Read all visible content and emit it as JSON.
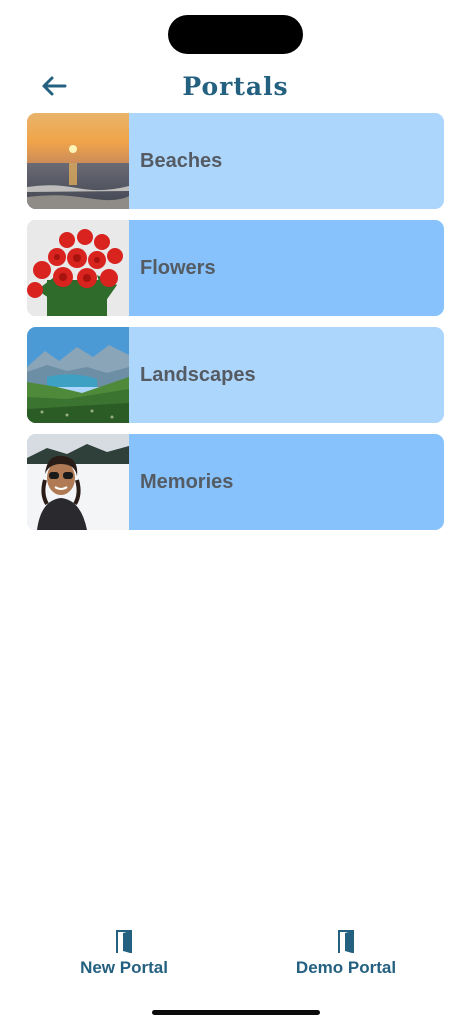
{
  "header": {
    "title": "Portals",
    "back_icon": "arrow-left-icon"
  },
  "portals": [
    {
      "label": "Beaches",
      "thumbnail": "sunset-beach-photo"
    },
    {
      "label": "Flowers",
      "thumbnail": "red-roses-photo"
    },
    {
      "label": "Landscapes",
      "thumbnail": "mountain-lake-photo"
    },
    {
      "label": "Memories",
      "thumbnail": "snow-selfie-photo"
    }
  ],
  "tabbar": {
    "new_portal_label": "New Portal",
    "demo_portal_label": "Demo Portal",
    "icon": "door-icon"
  },
  "colors": {
    "accent": "#24607f",
    "row_light": "#add6fd",
    "row_dark": "#87c2fc",
    "row_text": "#555b63"
  }
}
